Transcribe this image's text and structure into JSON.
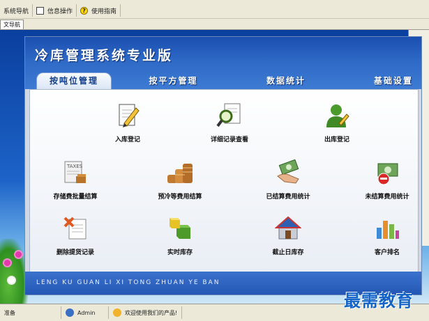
{
  "host": {
    "menu": [
      "...",
      "...",
      "..."
    ],
    "toolbar": [
      {
        "label": "系统导航",
        "icon": "none"
      },
      {
        "label": "信息操作",
        "icon": "checkbox-icon"
      },
      {
        "label": "使用指南",
        "icon": "help-icon"
      }
    ],
    "tab_label": "文导航"
  },
  "app": {
    "title": "冷库管理系统专业版",
    "tabs": [
      "按吨位管理",
      "按平方管理",
      "数据统计",
      "基础设置"
    ],
    "items": [
      {
        "label": "入库登记",
        "icon": "edit-document-icon"
      },
      {
        "label": "详细记录查看",
        "icon": "magnifier-icon"
      },
      {
        "label": "出库登记",
        "icon": "user-edit-icon"
      },
      {
        "label": "存储费批量结算",
        "icon": "taxes-calculator-icon"
      },
      {
        "label": "预冷等费用结算",
        "icon": "coin-stack-icon"
      },
      {
        "label": "已结算费用统计",
        "icon": "money-hand-icon"
      },
      {
        "label": "未结算费用统计",
        "icon": "money-no-icon"
      },
      {
        "label": "删除提货记录",
        "icon": "delete-document-icon"
      },
      {
        "label": "实时库存",
        "icon": "cubes-icon"
      },
      {
        "label": "截止日库存",
        "icon": "warehouse-icon"
      },
      {
        "label": "客户排名",
        "icon": "bar-ranking-icon"
      }
    ],
    "footer_text": "LENG KU GUAN LI XI TONG ZHUAN YE BAN"
  },
  "taskbar": {
    "items": [
      {
        "label": "准备",
        "icon": "none"
      },
      {
        "label": "Admin",
        "icon": "user-icon"
      },
      {
        "label": "欢迎使用我们的产品!",
        "icon": "info-icon"
      }
    ]
  },
  "watermark": "最需教育",
  "colors": {
    "header_blue": "#2e69c6",
    "footer_blue": "#2457b5",
    "panel_bg": "#ffffff",
    "watermark_blue": "#1464c8"
  }
}
